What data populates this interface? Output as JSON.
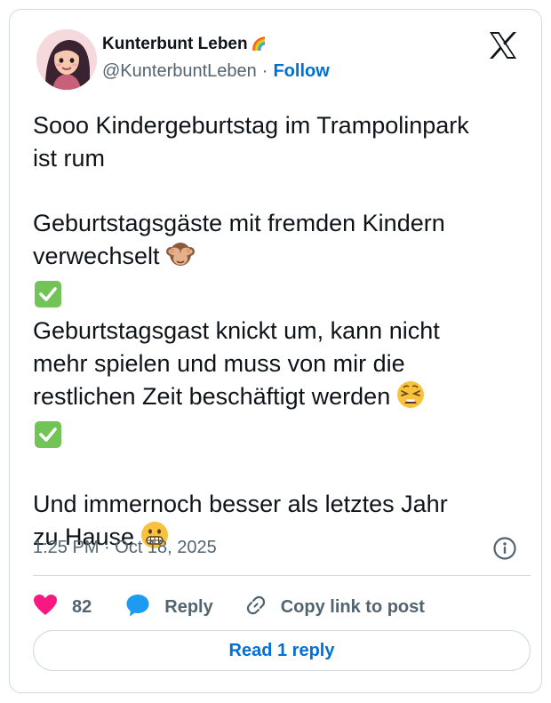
{
  "author": {
    "display_name": "Kunterbunt Leben",
    "name_emoji": "🌈",
    "handle": "@KunterbuntLeben",
    "separator": "·",
    "follow_label": "Follow"
  },
  "tweet": {
    "line1": "Sooo Kindergeburtstag im Trampolinpark",
    "line2": "ist rum",
    "line3": "Geburtstagsgäste mit fremden Kindern",
    "line4": "verwechselt",
    "line5": "Geburtstagsgast knickt um, kann nicht",
    "line6": "mehr spielen und muss von mir die",
    "line7": "restlichen Zeit beschäftigt werden",
    "line8": "Und immernoch besser als letztes Jahr",
    "line9": "zu Hause",
    "emojis": [
      "see-no-evil-monkey-icon",
      "check-mark-icon",
      "weary-face-icon",
      "check-mark-icon",
      "grimacing-face-icon"
    ]
  },
  "meta": {
    "timestamp": "1:25 PM · Oct 18, 2025"
  },
  "actions": {
    "like_count": "82",
    "reply_label": "Reply",
    "copy_label": "Copy link to post",
    "read_reply_label": "Read 1 reply"
  },
  "colors": {
    "like": "#f91880",
    "link": "#006fd6",
    "muted": "#536471",
    "border": "#cfd9de",
    "check_green": "#72c456"
  }
}
